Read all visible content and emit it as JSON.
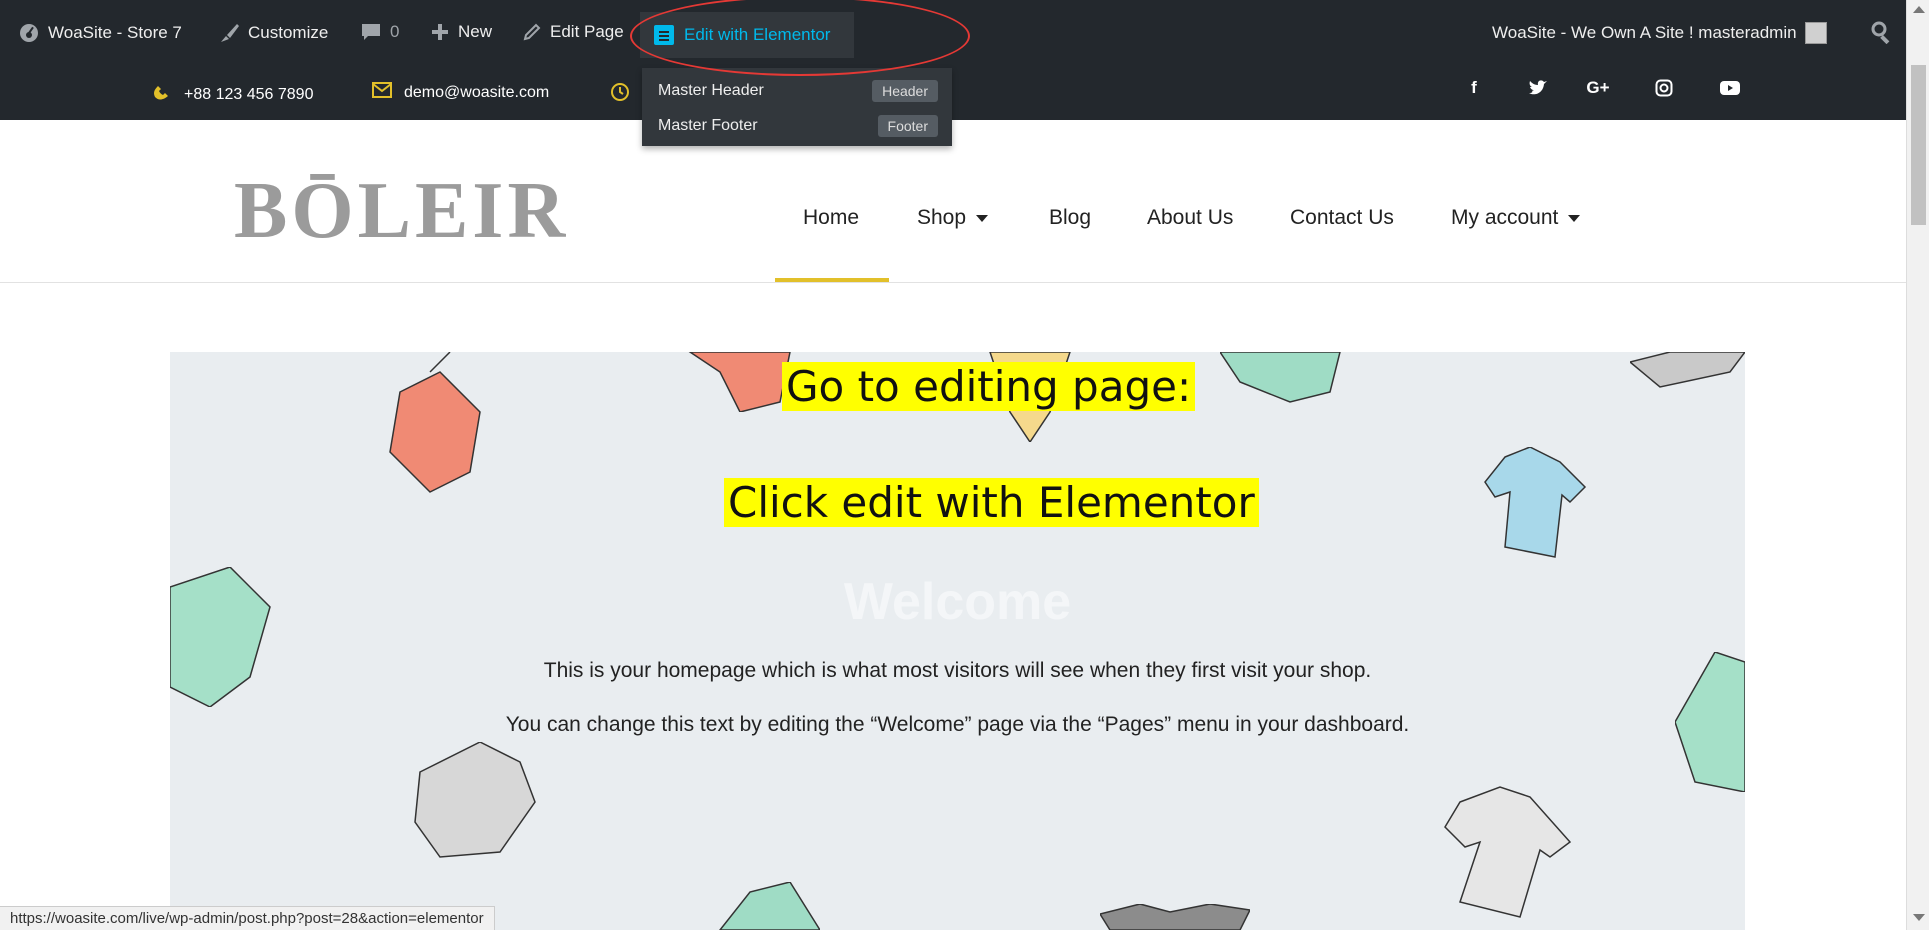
{
  "admin_bar": {
    "site_name": "WoaSite - Store 7",
    "customize": "Customize",
    "comments_count": "0",
    "new": "New",
    "edit_page": "Edit Page",
    "edit_with_elementor": "Edit with Elementor",
    "account_greeting": "WoaSite - We Own A Site ! masteradmin"
  },
  "elementor_dropdown": {
    "items": [
      {
        "label": "Master Header",
        "badge": "Header"
      },
      {
        "label": "Master Footer",
        "badge": "Footer"
      }
    ]
  },
  "topbar": {
    "phone": "+88 123 456 7890",
    "email": "demo@woasite.com",
    "social": [
      "facebook-icon",
      "twitter-icon",
      "google-plus-icon",
      "instagram-icon",
      "youtube-icon"
    ]
  },
  "header": {
    "logo": "BŌLEIR",
    "nav": [
      {
        "label": "Home",
        "dropdown": false
      },
      {
        "label": "Shop",
        "dropdown": true
      },
      {
        "label": "Blog",
        "dropdown": false
      },
      {
        "label": "About Us",
        "dropdown": false
      },
      {
        "label": "Contact Us",
        "dropdown": false
      },
      {
        "label": "My account",
        "dropdown": true
      }
    ],
    "active": "Home"
  },
  "annotations": {
    "line1": "Go to editing page:",
    "line2": "Click edit with Elementor"
  },
  "hero": {
    "title": "Welcome",
    "text1": "This is your homepage which is what most visitors will see when they first visit your shop.",
    "text2": "You can change this text by editing the “Welcome” page via the “Pages” menu in your dashboard."
  },
  "status_bar": {
    "url": "https://woasite.com/live/wp-admin/post.php?post=28&action=elementor"
  },
  "colors": {
    "admin_bar": "#23282d",
    "elementor_accent": "#00b9eb",
    "active_underline": "#e2c02a",
    "annotation_highlight": "#ffff00",
    "ring": "#e53935",
    "hero_bg": "#e9edf0"
  }
}
